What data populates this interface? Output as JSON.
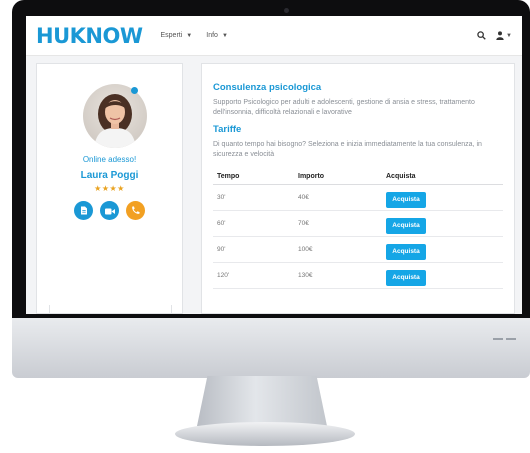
{
  "colors": {
    "brand": "#1a98d5",
    "accent": "#f2a022",
    "button": "#15a6e6"
  },
  "navbar": {
    "logo": "HUKNOW",
    "menu": [
      {
        "label": "Esperti",
        "icon": "chevron-down-icon"
      },
      {
        "label": "Info",
        "icon": "chevron-down-icon"
      }
    ],
    "right_icons": [
      "search-icon",
      "user-icon",
      "chevron-down-icon"
    ]
  },
  "profile": {
    "status": "Online adesso!",
    "name": "Laura Poggi",
    "rating": 4,
    "rating_text": "★★★★",
    "contact_icons": [
      "document-icon",
      "video-icon",
      "phone-icon"
    ]
  },
  "service": {
    "title": "Consulenza psicologica",
    "description": "Supporto Psicologico per adulti e adolescenti, gestione di ansia e stress, trattamento dell'insonnia, difficoltà relazionali e lavorative",
    "pricing_title": "Tariffe",
    "pricing_intro": "Di quanto tempo hai bisogno? Seleziona e inizia immediatamente la tua consulenza, in sicurezza e velocità",
    "table": {
      "headers": [
        "Tempo",
        "Importo",
        "Acquista"
      ],
      "rows": [
        {
          "time": "30'",
          "price": "40€",
          "button": "Acquista"
        },
        {
          "time": "60'",
          "price": "70€",
          "button": "Acquista"
        },
        {
          "time": "90'",
          "price": "100€",
          "button": "Acquista"
        },
        {
          "time": "120'",
          "price": "130€",
          "button": "Acquista"
        }
      ]
    }
  }
}
